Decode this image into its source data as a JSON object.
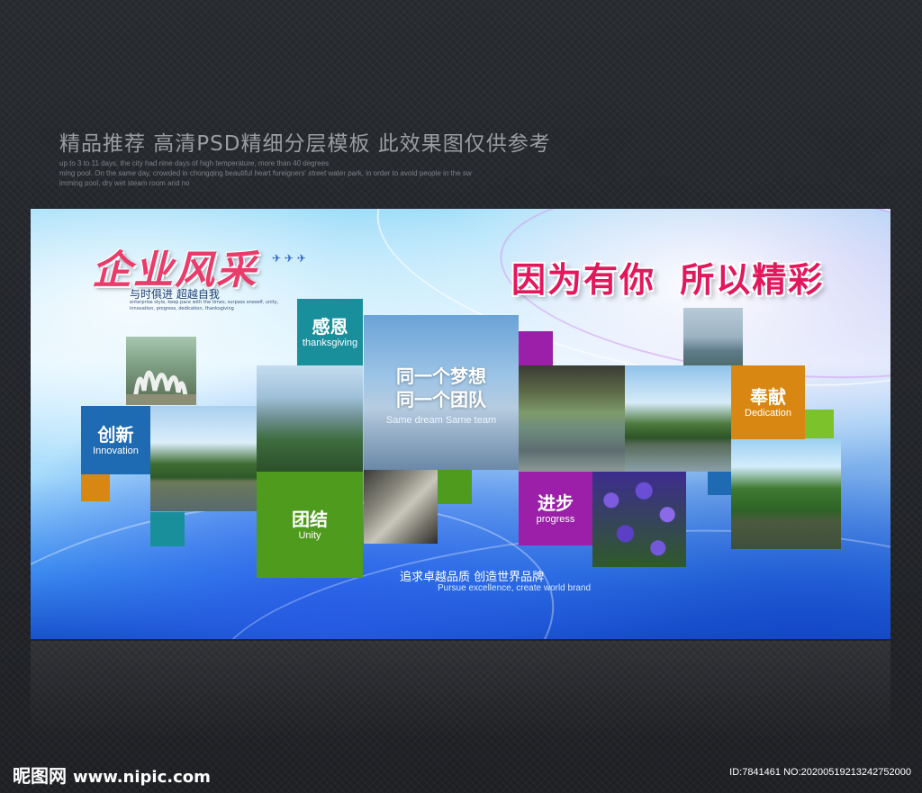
{
  "header": {
    "title": "精品推荐 高清PSD精细分层模板 此效果图仅供参考",
    "subtext": [
      "up to 3 to 11 days, the city had nine days of high temperature, more than 40 degrees",
      "ming pool. On the same day, crowded in chongqing beautiful heart foreigners' street water park, in order to avoid people in the sw",
      "imming pool, dry wet steam room and no"
    ]
  },
  "board": {
    "logo_title": "企业风采",
    "logo_subtitle": "与时俱进 超越自我",
    "logo_tiny": "enterprise style, keep pace with the times, surpass oneself, unity, innovation, progress, dedication, thanksgiving",
    "headline_part1": "因为有你",
    "headline_part2": "所以精彩",
    "blocks": {
      "thanksgiving": {
        "cn": "感恩",
        "en": "thanksgiving",
        "color": "#1a8f9c"
      },
      "innovation": {
        "cn": "创新",
        "en": "Innovation",
        "color": "#1e6bb3"
      },
      "unity": {
        "cn": "团结",
        "en": "Unity",
        "color": "#4f9b1e"
      },
      "progress": {
        "cn": "进步",
        "en": "progress",
        "color": "#9b1fa8"
      },
      "dedication": {
        "cn": "奉献",
        "en": "Dedication",
        "color": "#d98713"
      }
    },
    "center": {
      "line1": "同一个梦想",
      "line2": "同一个团队",
      "en": "Same dream Same team"
    },
    "slogan_cn": "追求卓越品质 创造世界品牌",
    "slogan_en": "Pursue excellence, create world brand"
  },
  "watermark": {
    "brand": "昵图网",
    "url": "www.nipic.com",
    "id_text": "ID:7841461 NO:20200519213242752000"
  }
}
